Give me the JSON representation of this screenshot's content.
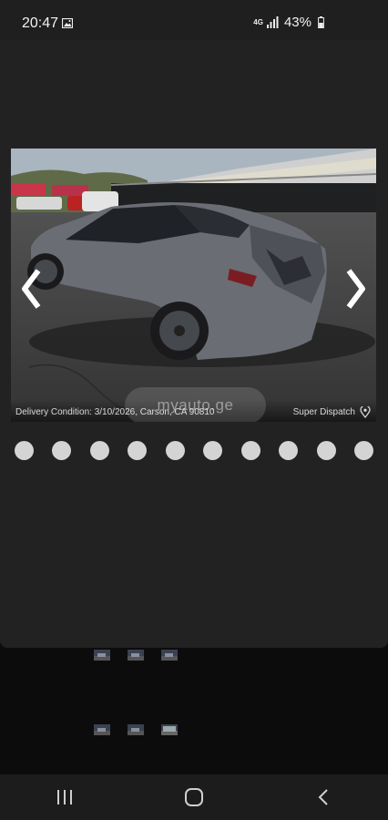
{
  "status_bar": {
    "time": "20:47",
    "network_label": "4G",
    "battery_percent": "43%",
    "icons": [
      "gallery-icon",
      "signal-icon",
      "battery-icon"
    ]
  },
  "gallery": {
    "caption_left": "Delivery Condition: 3/10/2026, Carson, CA 90810",
    "caption_right": "Super Dispatch",
    "watermark": "myauto.ge",
    "prev_arrow_icon": "chevron-left-icon",
    "next_arrow_icon": "chevron-right-icon",
    "location_icon": "map-pin-icon",
    "dot_count": 10,
    "thumbnail_rows": 2,
    "thumbnails_per_row": 3
  },
  "nav_bar": {
    "icons": [
      "recent-apps-icon",
      "home-icon",
      "back-icon"
    ]
  },
  "colors": {
    "background": "#0c0c0d",
    "modal": "#222223",
    "dot": "#d4d4d4"
  }
}
